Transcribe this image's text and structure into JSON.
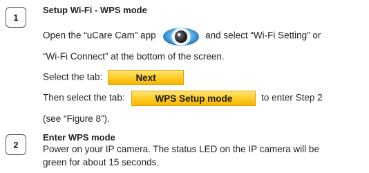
{
  "steps": [
    {
      "number": "1",
      "title": "Setup Wi-Fi - WPS mode",
      "line1_before_icon": "Open the “uCare Cam” app",
      "line1_after_icon": "and select “Wi-Fi Setting” or",
      "app_icon": "ucare-cam-app-icon",
      "line2": "“Wi-Fi Connect” at the bottom of the screen.",
      "line3_before_tab": "Select the tab:",
      "tab1_label": "Next",
      "line4_before_tab": "Then select the tab:",
      "tab2_label": "WPS Setup mode",
      "line4_after_tab": "to enter Step 2",
      "line5": "(see “Figure 8”)."
    },
    {
      "number": "2",
      "title": "Enter WPS mode",
      "body_line1": "Power on your IP camera. The status LED on the IP camera will be",
      "body_line2": "green for about 15 seconds."
    }
  ],
  "colors": {
    "tab_gradient_top": "#ffe57a",
    "tab_gradient_bottom": "#f5b500",
    "text": "#231f20"
  }
}
